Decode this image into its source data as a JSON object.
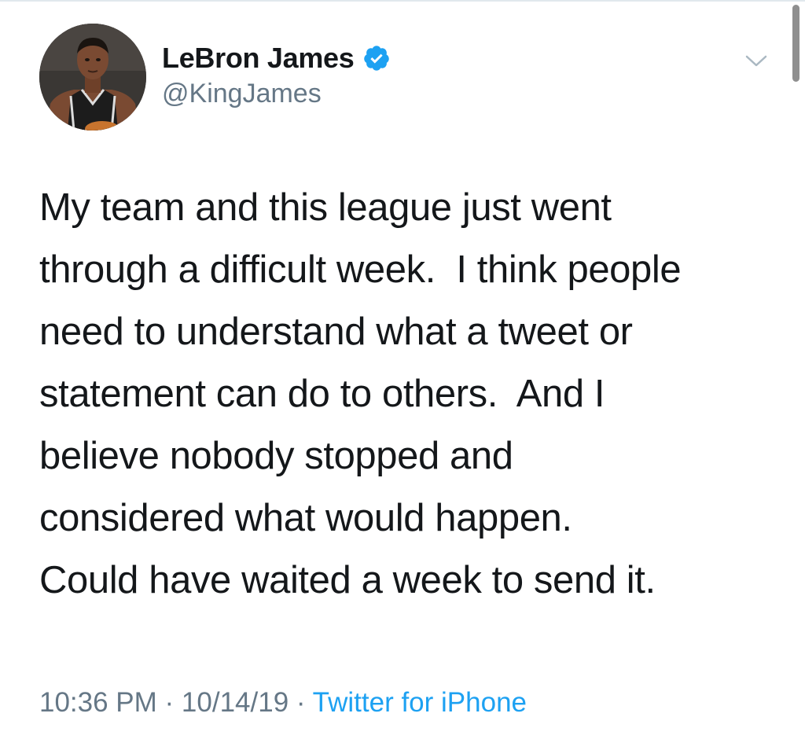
{
  "tweet": {
    "author": {
      "display_name": "LeBron James",
      "handle": "@KingJames",
      "verified": true,
      "avatar_icon": "profile-photo"
    },
    "text_lines": [
      "My team and this league just went",
      "through a difficult week.  I think people",
      "need to understand what a tweet or",
      "statement can do to others.  And I",
      "believe nobody stopped and",
      "considered what would happen.",
      "Could have waited a week to send it."
    ],
    "time": "10:36 PM",
    "separator": " · ",
    "date": "10/14/19",
    "source": "Twitter for iPhone",
    "menu_icon": "chevron-down-icon"
  },
  "colors": {
    "text": "#14171a",
    "secondary": "#657786",
    "link": "#1da1f2",
    "verified": "#1da1f2"
  }
}
